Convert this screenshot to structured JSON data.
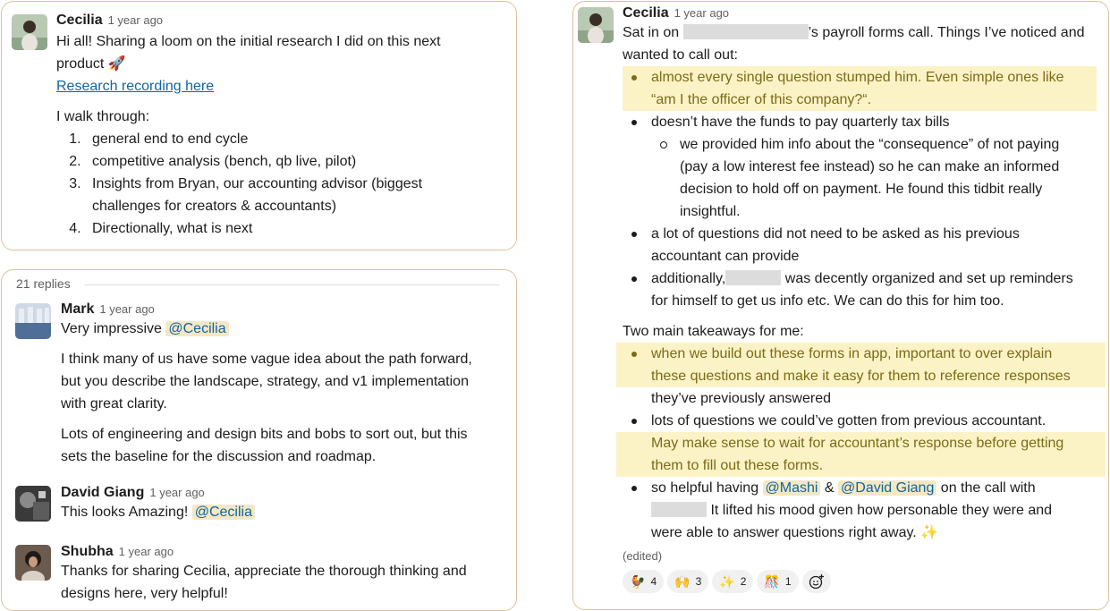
{
  "top_message": {
    "author": "Cecilia",
    "time": "1 year ago",
    "intro_line1": "Hi all! Sharing a loom on the initial research I did on this next",
    "intro_line2": "product",
    "emoji": "🚀",
    "link_text": "Research recording here",
    "walk_label": "I walk through:",
    "items": [
      "general end to end cycle",
      "competitive analysis (bench, qb live, pilot)",
      "Insights from Bryan, our accounting advisor (biggest challenges for creators & accountants)",
      "Directionally, what is next"
    ],
    "item3_line1": "Insights from Bryan, our accounting advisor (biggest",
    "item3_line2": "challenges for creators & accountants)"
  },
  "thread": {
    "replies_count": "21 replies",
    "replies": [
      {
        "author": "Mark",
        "time": "1 year ago",
        "text_prefix": "Very impressive",
        "mention": "@Cecilia",
        "para1": [
          "I think many of us have some vague idea about the path forward,",
          "but you describe the landscape, strategy, and v1 implementation",
          "with great clarity."
        ],
        "para2": [
          "Lots of engineering and design bits and bobs to sort out, but this",
          "sets the baseline for the discussion and roadmap."
        ]
      },
      {
        "author": "David Giang",
        "time": "1 year ago",
        "text_prefix": "This looks Amazing!",
        "mention": "@Cecilia"
      },
      {
        "author": "Shubha",
        "time": "1 year ago",
        "lines": [
          "Thanks for sharing Cecilia, appreciate the thorough thinking and",
          "designs here, very helpful!"
        ]
      }
    ]
  },
  "right_message": {
    "author": "Cecilia",
    "time": "1 year ago",
    "line1_prefix": "Sat in on",
    "line1_suffix": "’s payroll forms call. Things I’ve noticed and",
    "line2": "wanted to call out:",
    "b1": [
      "almost every single question stumped him. Even simple ones like",
      "“am I the officer of this company?“."
    ],
    "b2": "doesn’t have the funds to pay quarterly tax bills",
    "b2_sub": [
      "we provided him info about the “consequence” of not paying",
      "(pay a low interest fee instead) so he can make an informed",
      "decision to hold off on payment. He found this tidbit really",
      "insightful."
    ],
    "b3": [
      "a lot of questions did not need to be asked as his previous",
      "accountant can provide"
    ],
    "b4_prefix": "additionally,",
    "b4_suffix": "was decently organized and set up reminders",
    "b4_line2": "for himself to get us info etc. We can do this for him too.",
    "takeaways_label": "Two main takeaways for me:",
    "t1": [
      "when we build out these forms in app, important to over explain",
      "these questions and make it easy for them to reference responses"
    ],
    "t1_tail": "they’ve previously answered",
    "t2": "lots of questions we could’ve gotten from previous accountant.",
    "t2_hl": [
      "May make sense to wait for accountant’s response before getting",
      "them to fill out these forms."
    ],
    "t3_prefix": "so helpful having",
    "t3_mention1": "@Mashi",
    "t3_amp": "&",
    "t3_mention2": "@David Giang",
    "t3_suffix": "on the call with",
    "t3_line2": "It lifted his mood given how personable they were and",
    "t3_line3": "were able to answer questions right away.",
    "t3_emoji": "✨",
    "edited": "(edited)",
    "reactions": [
      {
        "icon": "🐓",
        "count": "4"
      },
      {
        "icon": "🙌",
        "count": "3"
      },
      {
        "icon": "✨",
        "count": "2"
      },
      {
        "icon": "🎊",
        "count": "1"
      }
    ],
    "add_reaction_icon": "add-reaction-icon"
  }
}
